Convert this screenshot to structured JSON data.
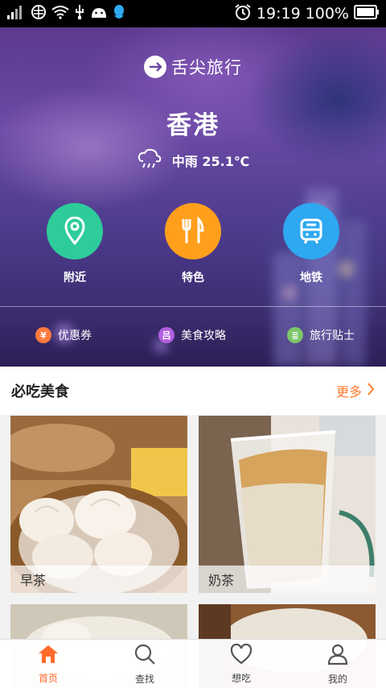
{
  "status_bar": {
    "time": "19:19",
    "battery_text": "100%",
    "icons": [
      "signal-icon",
      "network-icon",
      "wifi-icon",
      "usb-icon",
      "android-icon",
      "qq-icon",
      "alarm-icon",
      "battery-icon"
    ]
  },
  "hero": {
    "logo_text": "舌尖旅行",
    "city": "香港",
    "weather": {
      "icon": "cloud-rain-icon",
      "text": "中雨 25.1℃"
    },
    "quick_actions": [
      {
        "label": "附近",
        "icon": "location-pin-icon",
        "color": "#2ecc9a"
      },
      {
        "label": "特色",
        "icon": "fork-knife-icon",
        "color": "#ff9f1c"
      },
      {
        "label": "地铁",
        "icon": "metro-train-icon",
        "color": "#2ea8f0"
      }
    ],
    "links": [
      {
        "label": "优惠券",
        "icon": "yen-coupon-icon",
        "color": "#ff7a3d",
        "glyph": "¥"
      },
      {
        "label": "美食攻略",
        "icon": "guide-icon",
        "color": "#b35fe0",
        "glyph": "吕"
      },
      {
        "label": "旅行贴士",
        "icon": "tips-icon",
        "color": "#7cc56a",
        "glyph": "≣"
      }
    ]
  },
  "must_eat": {
    "title": "必吃美食",
    "more_label": "更多",
    "items": [
      {
        "label": "早茶"
      },
      {
        "label": "奶茶"
      },
      {
        "label": ""
      },
      {
        "label": ""
      }
    ]
  },
  "tabs": [
    {
      "label": "首页",
      "icon": "home-icon",
      "active": true
    },
    {
      "label": "查找",
      "icon": "search-icon",
      "active": false
    },
    {
      "label": "想吃",
      "icon": "heart-icon",
      "active": false
    },
    {
      "label": "我的",
      "icon": "user-icon",
      "active": false
    }
  ],
  "colors": {
    "accent": "#ff6a2b",
    "more": "#ff7a2b"
  }
}
